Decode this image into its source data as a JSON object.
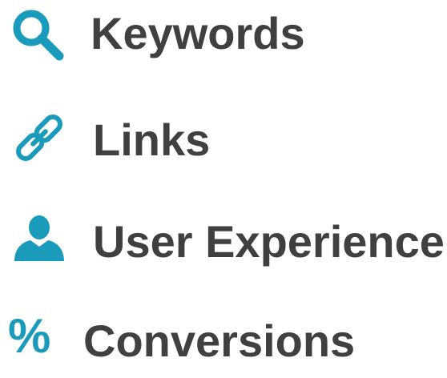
{
  "colors": {
    "icon": "#1a9bbc",
    "text": "#3f4042",
    "background": "#ffffff"
  },
  "items": [
    {
      "icon": "search-icon",
      "label": "Keywords"
    },
    {
      "icon": "link-icon",
      "label": "Links"
    },
    {
      "icon": "user-icon",
      "label": "User Experience"
    },
    {
      "icon": "percent-icon",
      "label": "Conversions",
      "glyph": "%"
    }
  ]
}
